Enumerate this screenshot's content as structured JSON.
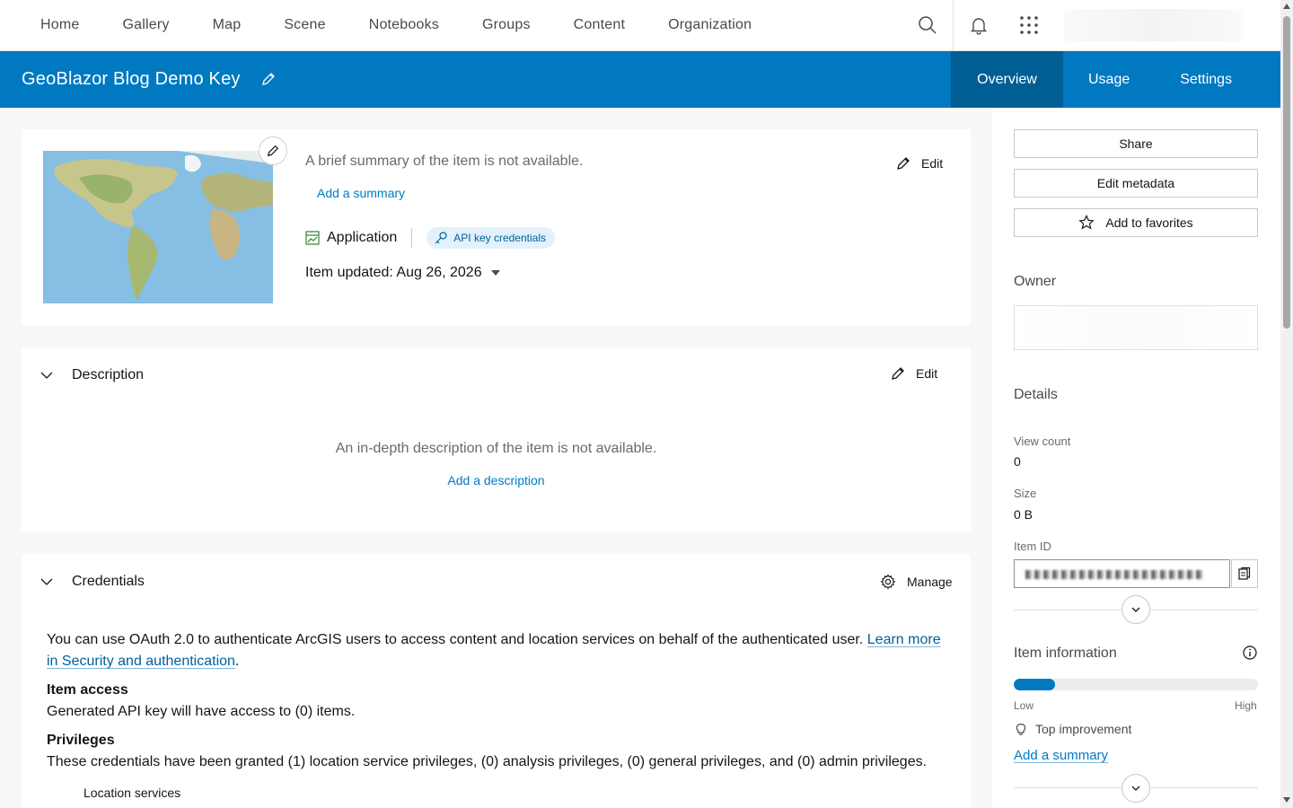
{
  "nav": {
    "links": [
      "Home",
      "Gallery",
      "Map",
      "Scene",
      "Notebooks",
      "Groups",
      "Content",
      "Organization"
    ],
    "icons": [
      "search-icon",
      "bell-icon",
      "app-launcher-icon"
    ]
  },
  "header": {
    "title": "GeoBlazor Blog Demo Key",
    "tabs": [
      "Overview",
      "Usage",
      "Settings"
    ],
    "active_tab": "Overview",
    "color": "#0079c1"
  },
  "summary_card": {
    "summary_placeholder": "A brief summary of the item is not available.",
    "add_summary": "Add a summary",
    "edit_label": "Edit",
    "type_label": "Application",
    "badge_label": "API key credentials",
    "updated_label": "Item updated: Aug 26, 2026"
  },
  "description": {
    "heading": "Description",
    "edit_label": "Edit",
    "empty_text": "An in-depth description of the item is not available.",
    "add_description": "Add a description"
  },
  "credentials": {
    "heading": "Credentials",
    "manage_label": "Manage",
    "intro": "You can use OAuth 2.0 to authenticate ArcGIS users to access content and location services on behalf of the authenticated user. ",
    "learn_link": "Learn more in Security and authentication",
    "intro_end": ".",
    "item_access_heading": "Item access",
    "item_access_text": "Generated API key will have access to (0) items.",
    "privileges_heading": "Privileges",
    "privileges_text": "These credentials have been granted (1) location service privileges, (0) analysis privileges, (0) general privileges, and (0) admin privileges.",
    "location_services": "Location services"
  },
  "sidebar": {
    "share": "Share",
    "edit_metadata": "Edit metadata",
    "add_favorites": "Add to favorites",
    "owner_heading": "Owner",
    "details_heading": "Details",
    "view_count_label": "View count",
    "view_count": "0",
    "size_label": "Size",
    "size": "0 B",
    "item_id_label": "Item ID",
    "item_info_heading": "Item information",
    "info_level": 0.17,
    "low_label": "Low",
    "high_label": "High",
    "top_improvement": "Top improvement",
    "add_summary": "Add a summary"
  }
}
